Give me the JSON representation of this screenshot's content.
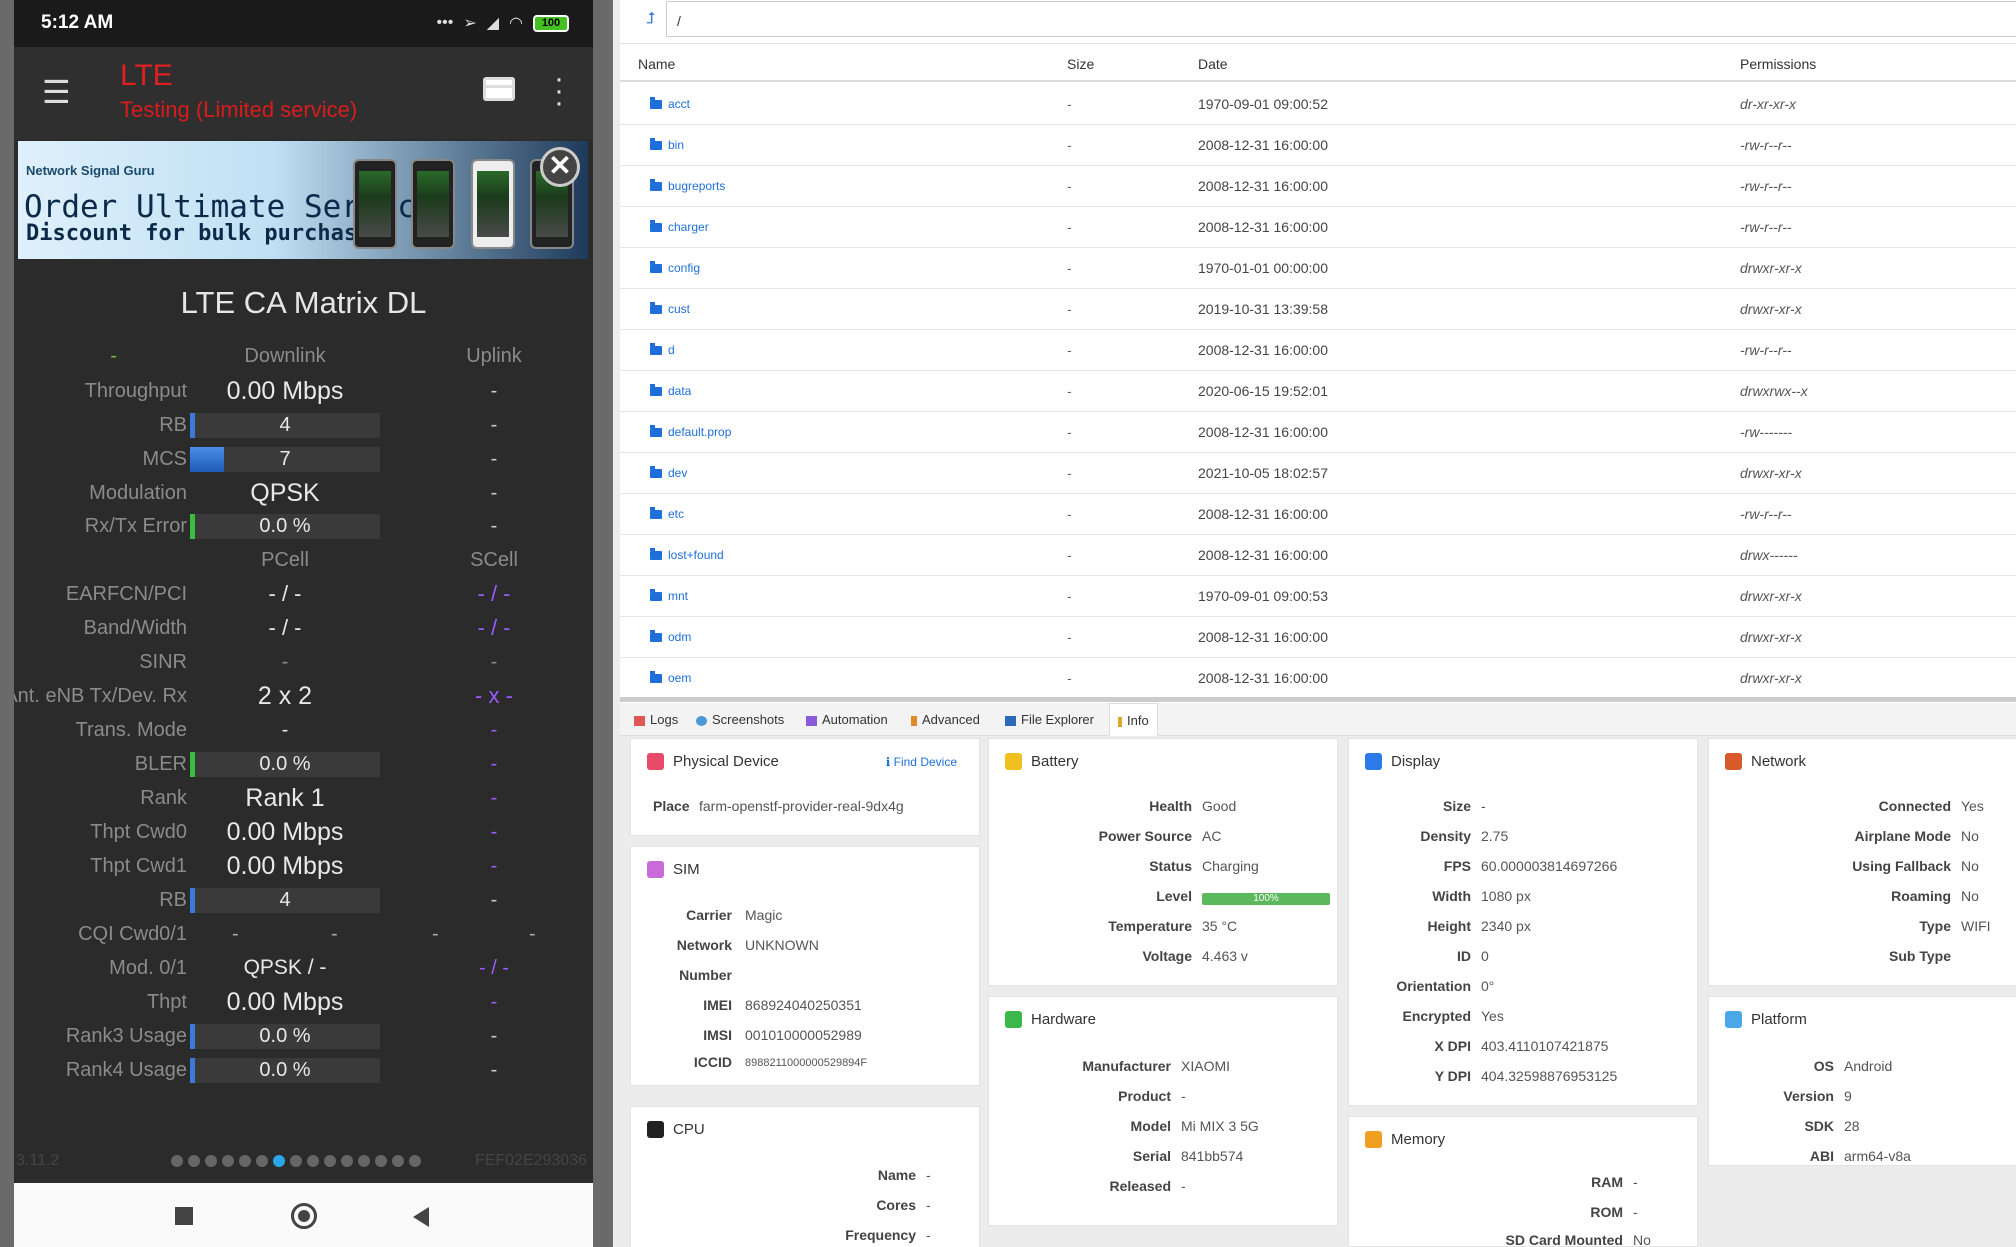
{
  "phone": {
    "status": {
      "time": "5:12 AM",
      "battery": "100"
    },
    "appbar": {
      "title": "LTE",
      "subtitle": "Testing (Limited service)"
    },
    "banner": {
      "brand": "Network Signal Guru",
      "headline": "Order Ultimate Service",
      "subline": "Discount for bulk purchases"
    },
    "matrix": {
      "title": "LTE CA Matrix DL",
      "header1": {
        "dash": "-",
        "c1": "Downlink",
        "c2": "Uplink"
      },
      "throughput": {
        "label": "Throughput",
        "c1": "0.00 Mbps",
        "c2": "-"
      },
      "rb": {
        "label": "RB",
        "c1": "4",
        "c2": "-"
      },
      "mcs": {
        "label": "MCS",
        "c1": "7",
        "c2": "-",
        "fill_pct": 18
      },
      "modulation": {
        "label": "Modulation",
        "c1": "QPSK",
        "c2": "-"
      },
      "rxtx_error": {
        "label": "Rx/Tx Error",
        "c1": "0.0 %",
        "c2": "-"
      },
      "header2": {
        "c1": "PCell",
        "c2": "SCell"
      },
      "earfcn": {
        "label": "EARFCN/PCI",
        "c1": "- / -",
        "c2": "- / -"
      },
      "band": {
        "label": "Band/Width",
        "c1": "- / -",
        "c2": "- / -"
      },
      "sinr": {
        "label": "SINR",
        "c1": "-",
        "c2": "-"
      },
      "ant": {
        "label": "Ant. eNB Tx/Dev. Rx",
        "c1": "2 x 2",
        "c2": "- x -"
      },
      "trans_mode": {
        "label": "Trans. Mode",
        "c1": "-",
        "c2": "-"
      },
      "bler": {
        "label": "BLER",
        "c1": "0.0 %",
        "c2": "-"
      },
      "rank": {
        "label": "Rank",
        "c1": "Rank 1",
        "c2": "-"
      },
      "thpt_cwd0": {
        "label": "Thpt Cwd0",
        "c1": "0.00 Mbps",
        "c2": "-"
      },
      "thpt_cwd1": {
        "label": "Thpt Cwd1",
        "c1": "0.00 Mbps",
        "c2": "-"
      },
      "rb2": {
        "label": "RB",
        "c1": "4",
        "c2": "-"
      },
      "cqi": {
        "label": "CQI Cwd0/1",
        "a": "-",
        "b": "-",
        "c": "-",
        "d": "-"
      },
      "mod01": {
        "label": "Mod. 0/1",
        "c1": "QPSK / -",
        "c2": "- / -"
      },
      "thpt": {
        "label": "Thpt",
        "c1": "0.00 Mbps",
        "c2": "-"
      },
      "rank3": {
        "label": "Rank3 Usage",
        "c1": "0.0 %",
        "c2": "-"
      },
      "rank4": {
        "label": "Rank4 Usage",
        "c1": "0.0 %",
        "c2": "-"
      }
    },
    "pager": {
      "version": "3.11.2",
      "device_id": "FEF02E293036",
      "pages": 15,
      "active_index": 6
    }
  },
  "explorer": {
    "path": "/",
    "columns": {
      "name": "Name",
      "size": "Size",
      "date": "Date",
      "permissions": "Permissions"
    },
    "files": [
      {
        "name": "acct",
        "size": "-",
        "date": "1970-09-01 09:00:52",
        "perm": "dr-xr-xr-x"
      },
      {
        "name": "bin",
        "size": "-",
        "date": "2008-12-31 16:00:00",
        "perm": "-rw-r--r--"
      },
      {
        "name": "bugreports",
        "size": "-",
        "date": "2008-12-31 16:00:00",
        "perm": "-rw-r--r--"
      },
      {
        "name": "charger",
        "size": "-",
        "date": "2008-12-31 16:00:00",
        "perm": "-rw-r--r--"
      },
      {
        "name": "config",
        "size": "-",
        "date": "1970-01-01 00:00:00",
        "perm": "drwxr-xr-x"
      },
      {
        "name": "cust",
        "size": "-",
        "date": "2019-10-31 13:39:58",
        "perm": "drwxr-xr-x"
      },
      {
        "name": "d",
        "size": "-",
        "date": "2008-12-31 16:00:00",
        "perm": "-rw-r--r--"
      },
      {
        "name": "data",
        "size": "-",
        "date": "2020-06-15 19:52:01",
        "perm": "drwxrwx--x"
      },
      {
        "name": "default.prop",
        "size": "-",
        "date": "2008-12-31 16:00:00",
        "perm": "-rw-------"
      },
      {
        "name": "dev",
        "size": "-",
        "date": "2021-10-05 18:02:57",
        "perm": "drwxr-xr-x"
      },
      {
        "name": "etc",
        "size": "-",
        "date": "2008-12-31 16:00:00",
        "perm": "-rw-r--r--"
      },
      {
        "name": "lost+found",
        "size": "-",
        "date": "2008-12-31 16:00:00",
        "perm": "drwx------"
      },
      {
        "name": "mnt",
        "size": "-",
        "date": "1970-09-01 09:00:53",
        "perm": "drwxr-xr-x"
      },
      {
        "name": "odm",
        "size": "-",
        "date": "2008-12-31 16:00:00",
        "perm": "drwxr-xr-x"
      },
      {
        "name": "oem",
        "size": "-",
        "date": "2008-12-31 16:00:00",
        "perm": "drwxr-xr-x"
      }
    ]
  },
  "tabs": {
    "logs": "Logs",
    "screenshots": "Screenshots",
    "automation": "Automation",
    "advanced": "Advanced",
    "file_explorer": "File Explorer",
    "info": "Info"
  },
  "info": {
    "physical": {
      "title": "Physical Device",
      "find": "Find Device",
      "place_k": "Place",
      "place_v": "farm-openstf-provider-real-9dx4g"
    },
    "sim": {
      "title": "SIM",
      "carrier_k": "Carrier",
      "carrier_v": "Magic",
      "network_k": "Network",
      "network_v": "UNKNOWN",
      "number_k": "Number",
      "imei_k": "IMEI",
      "imei_v": "868924040250351",
      "imsi_k": "IMSI",
      "imsi_v": "001010000052989",
      "iccid_k": "ICCID",
      "iccid_v": "8988211000000529894F"
    },
    "cpu": {
      "title": "CPU",
      "name_k": "Name",
      "name_v": "-",
      "cores_k": "Cores",
      "cores_v": "-",
      "freq_k": "Frequency",
      "freq_v": "-"
    },
    "battery": {
      "title": "Battery",
      "health_k": "Health",
      "health_v": "Good",
      "power_k": "Power Source",
      "power_v": "AC",
      "status_k": "Status",
      "status_v": "Charging",
      "level_k": "Level",
      "level_v": "100%",
      "temp_k": "Temperature",
      "temp_v": "35 °C",
      "volt_k": "Voltage",
      "volt_v": "4.463 v"
    },
    "hardware": {
      "title": "Hardware",
      "manu_k": "Manufacturer",
      "manu_v": "XIAOMI",
      "product_k": "Product",
      "product_v": "-",
      "model_k": "Model",
      "model_v": "Mi MIX 3 5G",
      "serial_k": "Serial",
      "serial_v": "841bb574",
      "released_k": "Released",
      "released_v": "-"
    },
    "display": {
      "title": "Display",
      "size_k": "Size",
      "size_v": "-",
      "density_k": "Density",
      "density_v": "2.75",
      "fps_k": "FPS",
      "fps_v": "60.000003814697266",
      "width_k": "Width",
      "width_v": "1080 px",
      "height_k": "Height",
      "height_v": "2340 px",
      "id_k": "ID",
      "id_v": "0",
      "orient_k": "Orientation",
      "orient_v": "0°",
      "enc_k": "Encrypted",
      "enc_v": "Yes",
      "xdpi_k": "X DPI",
      "xdpi_v": "403.4110107421875",
      "ydpi_k": "Y DPI",
      "ydpi_v": "404.32598876953125"
    },
    "memory": {
      "title": "Memory",
      "ram_k": "RAM",
      "ram_v": "-",
      "rom_k": "ROM",
      "rom_v": "-",
      "sd_k": "SD Card Mounted",
      "sd_v": "No"
    },
    "network": {
      "title": "Network",
      "conn_k": "Connected",
      "conn_v": "Yes",
      "air_k": "Airplane Mode",
      "air_v": "No",
      "fallback_k": "Using Fallback",
      "fallback_v": "No",
      "roam_k": "Roaming",
      "roam_v": "No",
      "type_k": "Type",
      "type_v": "WIFI",
      "subtype_k": "Sub Type"
    },
    "platform": {
      "title": "Platform",
      "os_k": "OS",
      "os_v": "Android",
      "ver_k": "Version",
      "ver_v": "9",
      "sdk_k": "SDK",
      "sdk_v": "28",
      "abi_k": "ABI",
      "abi_v": "arm64-v8a"
    }
  },
  "colors": {
    "accent_blue": "#1e6fd9",
    "lte_red": "#e02020",
    "scell_purple": "#9a5cff",
    "level_green": "#5cb85c"
  }
}
